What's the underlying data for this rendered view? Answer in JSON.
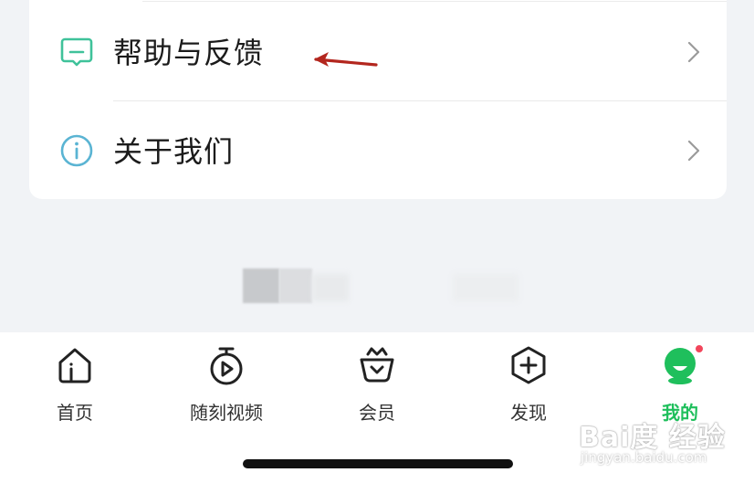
{
  "menu": {
    "items": [
      {
        "label": "帮助与反馈",
        "icon": "help-feedback-icon"
      },
      {
        "label": "关于我们",
        "icon": "info-icon"
      }
    ]
  },
  "tabbar": {
    "tabs": [
      {
        "label": "首页",
        "icon": "home-icon"
      },
      {
        "label": "随刻视频",
        "icon": "play-clock-icon"
      },
      {
        "label": "会员",
        "icon": "crown-basket-icon"
      },
      {
        "label": "发现",
        "icon": "hexagon-plus-icon"
      },
      {
        "label": "我的",
        "icon": "avatar-icon",
        "active": true
      }
    ]
  },
  "watermark": {
    "main": "Bai度 经验",
    "sub": "jingyan.baidu.com"
  },
  "colors": {
    "accent": "#1fbf5c",
    "help_icon": "#3fc29a",
    "info_icon": "#5ab4d3",
    "annotation_arrow": "#b3261e",
    "badge": "#f2455b"
  }
}
